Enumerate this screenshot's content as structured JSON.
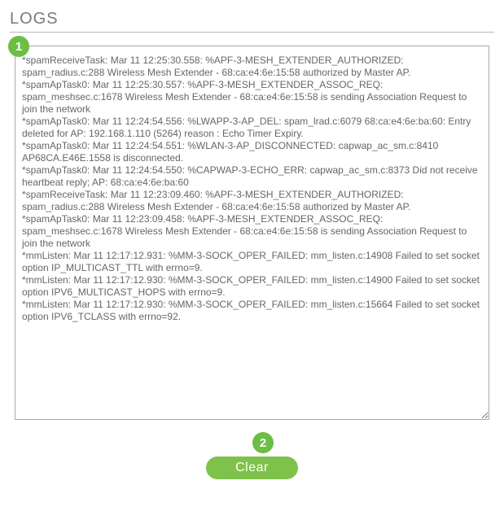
{
  "header": {
    "title": "LOGS"
  },
  "badges": {
    "one": "1",
    "two": "2"
  },
  "log_text": "*spamReceiveTask: Mar 11 12:25:30.558: %APF-3-MESH_EXTENDER_AUTHORIZED: spam_radius.c:288 Wireless Mesh Extender - 68:ca:e4:6e:15:58 authorized by Master AP.\n*spamApTask0: Mar 11 12:25:30.557: %APF-3-MESH_EXTENDER_ASSOC_REQ: spam_meshsec.c:1678 Wireless Mesh Extender - 68:ca:e4:6e:15:58 is sending Association Request to join the network\n*spamApTask0: Mar 11 12:24:54.556: %LWAPP-3-AP_DEL: spam_lrad.c:6079 68:ca:e4:6e:ba:60: Entry deleted for AP: 192.168.1.110 (5264) reason : Echo Timer Expiry.\n*spamApTask0: Mar 11 12:24:54.551: %WLAN-3-AP_DISCONNECTED: capwap_ac_sm.c:8410 AP68CA.E46E.1558 is disconnected.\n*spamApTask0: Mar 11 12:24:54.550: %CAPWAP-3-ECHO_ERR: capwap_ac_sm.c:8373 Did not receive heartbeat reply; AP: 68:ca:e4:6e:ba:60\n*spamReceiveTask: Mar 11 12:23:09.460: %APF-3-MESH_EXTENDER_AUTHORIZED: spam_radius.c:288 Wireless Mesh Extender - 68:ca:e4:6e:15:58 authorized by Master AP.\n*spamApTask0: Mar 11 12:23:09.458: %APF-3-MESH_EXTENDER_ASSOC_REQ: spam_meshsec.c:1678 Wireless Mesh Extender - 68:ca:e4:6e:15:58 is sending Association Request to join the network\n*mmListen: Mar 11 12:17:12.931: %MM-3-SOCK_OPER_FAILED: mm_listen.c:14908 Failed to set socket option IP_MULTICAST_TTL with errno=9.\n*mmListen: Mar 11 12:17:12.930: %MM-3-SOCK_OPER_FAILED: mm_listen.c:14900 Failed to set socket option IPV6_MULTICAST_HOPS with errno=9.\n*mmListen: Mar 11 12:17:12.930: %MM-3-SOCK_OPER_FAILED: mm_listen.c:15664 Failed to set socket option IPV6_TCLASS with errno=92.",
  "buttons": {
    "clear": "Clear"
  }
}
